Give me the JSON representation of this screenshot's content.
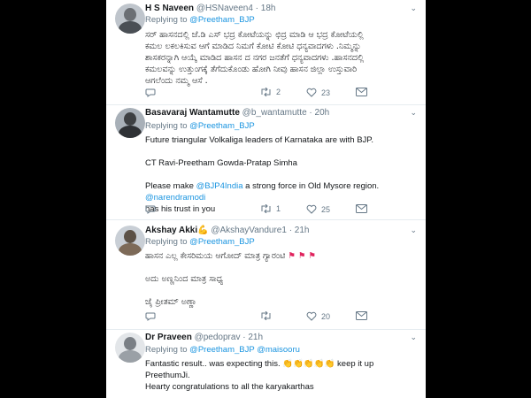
{
  "tweets": [
    {
      "name": "H S Naveen",
      "handle": "@HSNaveen4",
      "time": "· 18h",
      "replying_prefix": "Replying to",
      "replying_to": "@Preetham_BJP",
      "lines": [
        "ಸರ್ ಹಾಸನದಲ್ಲಿ ಜೆ.ಡಿ ಎಸ್ ಭದ್ರ ಕೋಟೆಯನ್ನು ಛಿದ್ರ ಮಾಡಿ ಆ ಭದ್ರ ಕೋಟೆಯಲ್ಲಿ",
        "ಕಮಲ ಲಕಲಕಿಸುವ ಆಗೆ ಮಾಡಿದ ನಿಮಗೆ ಕೋಟಿ ಕೋಟಿ ಧನ್ಯವಾದಗಳು .ನಿಮ್ಮನ್ನು",
        "ಶಾಸಕರನ್ನಾಗಿ ಆಯ್ಕೆ ಮಾಡಿದ ಹಾಸನ ದ ನಗರ ಜನತೆಗೆ ಧನ್ಯವಾದಗಳು .ಹಾಸನದಲ್ಲಿ",
        "ಕಮಲವನ್ನು ಉತ್ತುಂಗಕ್ಕೆ ತೆಗೆದುಕೊಂಡು ಹೋಗಿ ನೀವು ಹಾಸನ ಜಿಲ್ಲಾ ಉಸ್ತುವಾರಿ",
        "ಆಗಲೆಂದು ನಮ್ಮ ಆಸೆ ."
      ],
      "retweets": "2",
      "likes": "23"
    },
    {
      "name": "Basavaraj Wantamutte",
      "handle": "@b_wantamutte",
      "time": "· 20h",
      "replying_prefix": "Replying to",
      "replying_to": "@Preetham_BJP",
      "line1": "Future triangular Volkaliga leaders of Karnataka are with BJP.",
      "line2": "CT Ravi-Preetham Gowda-Pratap Simha",
      "line3_pre": "Please make ",
      "line3_link": "@BJP4India",
      "line3_mid": " a strong force in Old Mysore region. ",
      "line3_link2": "@narendramodi",
      "line4": "has his trust in you",
      "retweets": "1",
      "likes": "25"
    },
    {
      "name": "Akshay Akki",
      "name_emoji": "💪",
      "handle": "@AkshayVandure1",
      "time": "· 21h",
      "replying_prefix": "Replying to",
      "replying_to": "@Preetham_BJP",
      "line1": "ಹಾಸನ ಎಲ್ಲ ಕೇಸರಿಮಯ ಆಗೋದ್ ಮಾತ್ರ ಗ್ಯಾರಂಟಿ",
      "line1_flags": "⚑ ⚑ ⚑",
      "line2": "ಅದು ಅಣ್ಣನಿಂದ ಮಾತ್ರ ಸಾಧ್ಯ",
      "line3": "ಜೈ ಪ್ರೀತಮ್ ಅಣ್ಣಾ",
      "likes": "20"
    },
    {
      "name": "Dr Praveen",
      "handle": "@pedoprav",
      "time": "· 21h",
      "replying_prefix": "Replying to",
      "replying_to": "@Preetham_BJP",
      "replying_and": "@maisooru",
      "line1_pre": "Fantastic result.. was expecting this.",
      "line1_emoji": "👏👏👏👏👏",
      "line1_post": " keep it up PreethumJi.",
      "line2": "Hearty congratulations to all the karyakarthas"
    }
  ],
  "colors": {
    "link": "#1b95e0",
    "muted": "#657786",
    "text": "#14171a",
    "background": "#000000"
  }
}
